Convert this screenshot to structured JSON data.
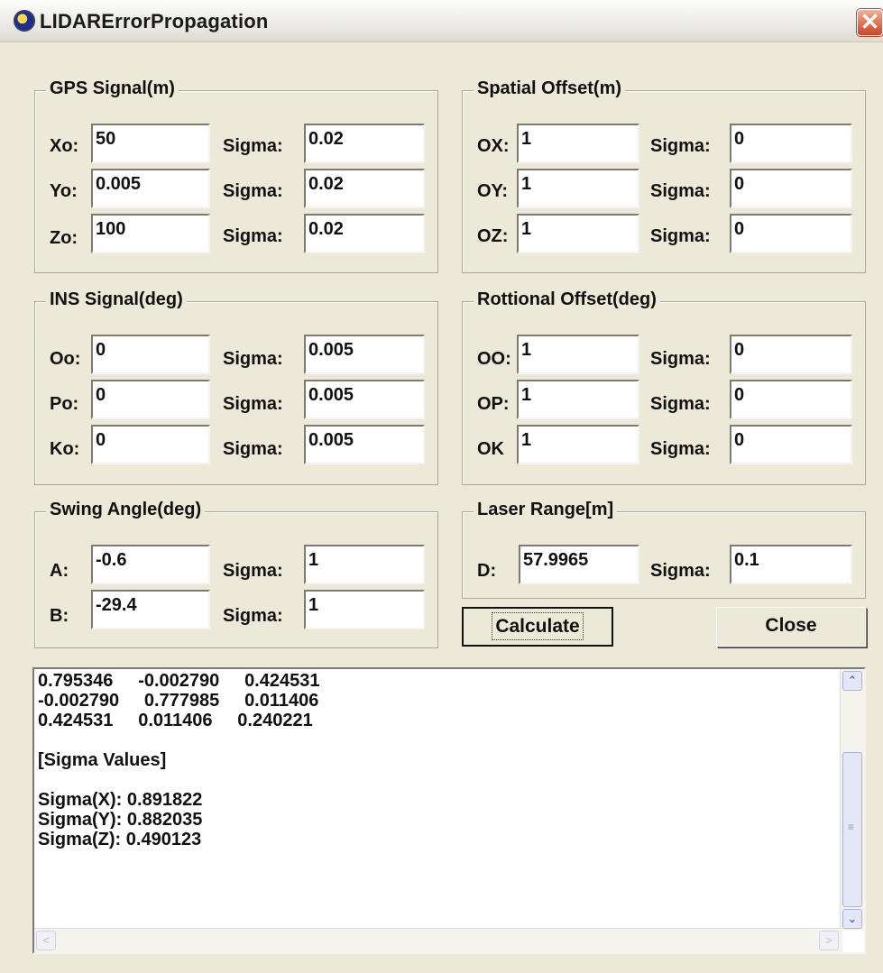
{
  "window": {
    "title": "LIDARErrorPropagation",
    "close_glyph": "✕"
  },
  "gps": {
    "title": "GPS Signal(m)",
    "rows": [
      {
        "label": "Xo:",
        "value": "50",
        "sigma_label": "Sigma:",
        "sigma": "0.02"
      },
      {
        "label": "Yo:",
        "value": "0.005",
        "sigma_label": "Sigma:",
        "sigma": "0.02"
      },
      {
        "label": "Zo:",
        "value": "100",
        "sigma_label": "Sigma:",
        "sigma": "0.02"
      }
    ]
  },
  "spatial": {
    "title": "Spatial Offset(m)",
    "rows": [
      {
        "label": "OX:",
        "value": "1",
        "sigma_label": "Sigma:",
        "sigma": "0"
      },
      {
        "label": "OY:",
        "value": "1",
        "sigma_label": "Sigma:",
        "sigma": "0"
      },
      {
        "label": "OZ:",
        "value": "1",
        "sigma_label": "Sigma:",
        "sigma": "0"
      }
    ]
  },
  "ins": {
    "title": "INS Signal(deg)",
    "rows": [
      {
        "label": "Oo:",
        "value": "0",
        "sigma_label": "Sigma:",
        "sigma": "0.005"
      },
      {
        "label": "Po:",
        "value": "0",
        "sigma_label": "Sigma:",
        "sigma": "0.005"
      },
      {
        "label": "Ko:",
        "value": "0",
        "sigma_label": "Sigma:",
        "sigma": "0.005"
      }
    ]
  },
  "rotational": {
    "title": "Rottional Offset(deg)",
    "rows": [
      {
        "label": "OO:",
        "value": "1",
        "sigma_label": "Sigma:",
        "sigma": "0"
      },
      {
        "label": "OP:",
        "value": "1",
        "sigma_label": "Sigma:",
        "sigma": "0"
      },
      {
        "label": "OK",
        "value": "1",
        "sigma_label": "Sigma:",
        "sigma": "0"
      }
    ]
  },
  "swing": {
    "title": "Swing Angle(deg)",
    "rows": [
      {
        "label": "A:",
        "value": "-0.6",
        "sigma_label": "Sigma:",
        "sigma": "1"
      },
      {
        "label": "B:",
        "value": "-29.4",
        "sigma_label": "Sigma:",
        "sigma": "1"
      }
    ]
  },
  "laser": {
    "title": "Laser Range[m]",
    "rows": [
      {
        "label": "D:",
        "value": "57.9965",
        "sigma_label": "Sigma:",
        "sigma": "0.1"
      }
    ]
  },
  "buttons": {
    "calculate": "Calculate",
    "close": "Close"
  },
  "output": {
    "text": "0.795346     -0.002790     0.424531\n-0.002790     0.777985     0.011406\n0.424531     0.011406     0.240221\n\n[Sigma Values]\n\nSigma(X): 0.891822\nSigma(Y): 0.882035\nSigma(Z): 0.490123",
    "scroll_up": "⌃",
    "scroll_down": "⌄",
    "scroll_left": "<",
    "scroll_right": ">",
    "grip": "≡"
  },
  "icons": {
    "app": "app-icon",
    "close": "close-icon"
  }
}
